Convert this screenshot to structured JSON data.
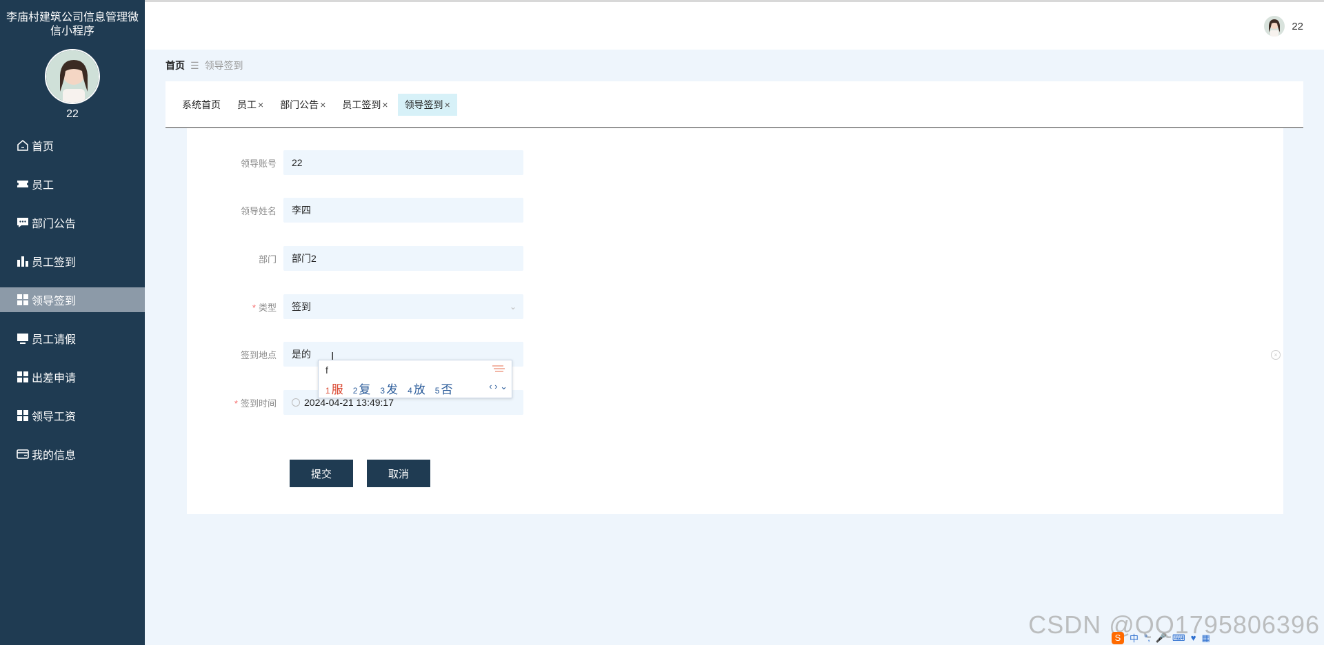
{
  "app": {
    "title": "李庙村建筑公司信息管理微信小程序",
    "username": "22"
  },
  "sidebar": {
    "items": [
      {
        "label": "首页",
        "icon": "home-icon",
        "active": false
      },
      {
        "label": "员工",
        "icon": "ticket-icon",
        "active": false
      },
      {
        "label": "部门公告",
        "icon": "message-icon",
        "active": false
      },
      {
        "label": "员工签到",
        "icon": "bar-chart-icon",
        "active": false
      },
      {
        "label": "领导签到",
        "icon": "grid-icon",
        "active": true
      },
      {
        "label": "员工请假",
        "icon": "monitor-icon",
        "active": false
      },
      {
        "label": "出差申请",
        "icon": "grid-icon",
        "active": false
      },
      {
        "label": "领导工资",
        "icon": "grid-icon",
        "active": false
      },
      {
        "label": "我的信息",
        "icon": "card-icon",
        "active": false
      }
    ]
  },
  "header": {
    "username": "22"
  },
  "breadcrumb": {
    "home": "首页",
    "current": "领导签到"
  },
  "tabs": [
    {
      "label": "系统首页",
      "closable": false,
      "active": false
    },
    {
      "label": "员工",
      "closable": true,
      "active": false
    },
    {
      "label": "部门公告",
      "closable": true,
      "active": false
    },
    {
      "label": "员工签到",
      "closable": true,
      "active": false
    },
    {
      "label": "领导签到",
      "closable": true,
      "active": true
    }
  ],
  "form": {
    "account": {
      "label": "领导账号",
      "value": "22"
    },
    "name": {
      "label": "领导姓名",
      "value": "李四"
    },
    "dept": {
      "label": "部门",
      "value": "部门2"
    },
    "type": {
      "label": "类型",
      "value": "签到",
      "required": true
    },
    "location": {
      "label": "签到地点",
      "value": "是的"
    },
    "time": {
      "label": "签到时间",
      "value": "2024-04-21 13:49:17",
      "required": true
    },
    "submit_label": "提交",
    "cancel_label": "取消"
  },
  "ime": {
    "composition": "f",
    "candidates": [
      {
        "n": "1",
        "text": "服"
      },
      {
        "n": "2",
        "text": "复"
      },
      {
        "n": "3",
        "text": "发"
      },
      {
        "n": "4",
        "text": "放"
      },
      {
        "n": "5",
        "text": "否"
      }
    ],
    "nav": "‹ › ⌄"
  },
  "watermark": "CSDN @QQ1795806396",
  "tray": {
    "lang": "中"
  },
  "colors": {
    "sidebar": "#1f3b52",
    "active_item": "#8c9aa8",
    "button": "#1f3b52",
    "field_bg": "#eef6fd",
    "active_tab": "#d7f1f8"
  }
}
